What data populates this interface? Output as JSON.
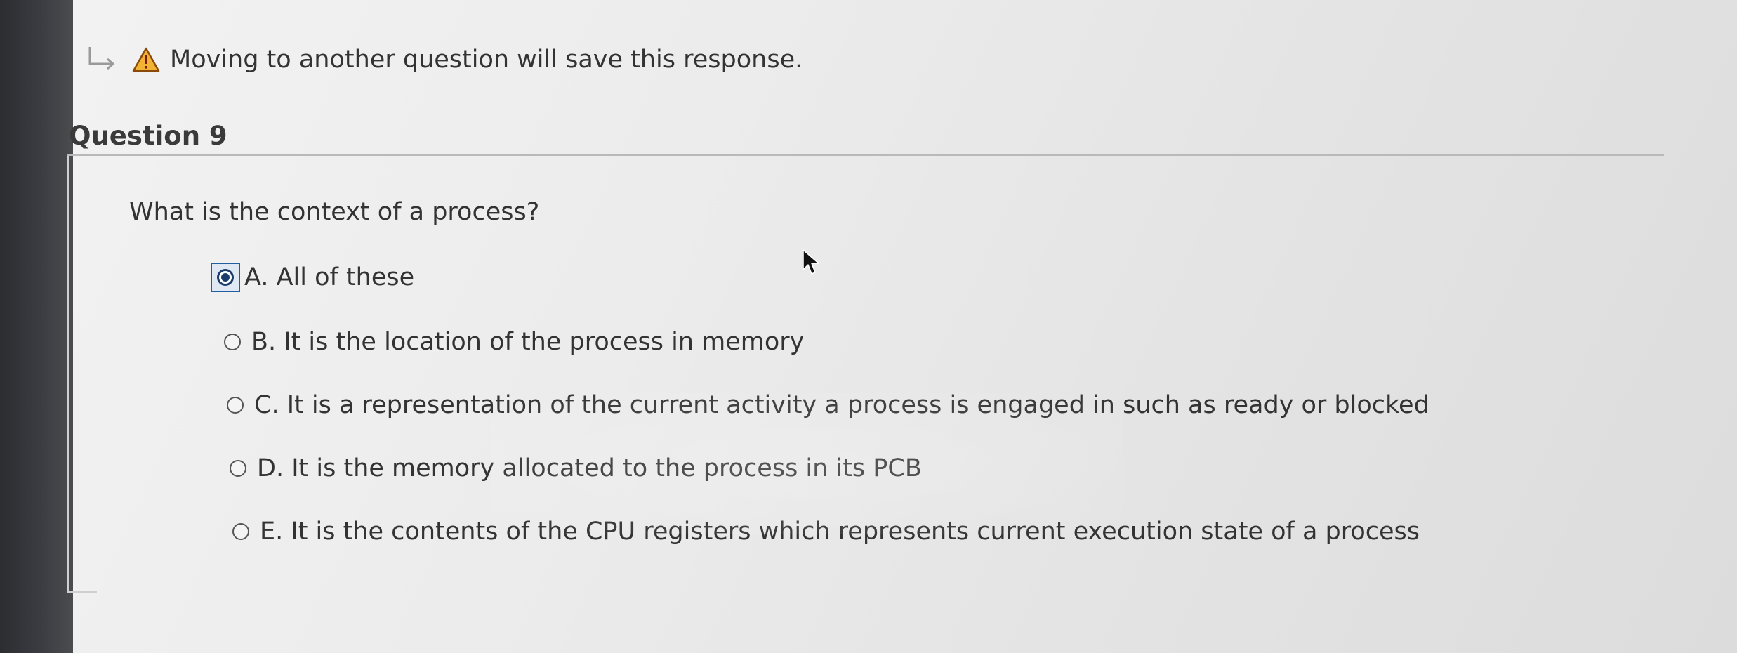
{
  "notice": {
    "text": "Moving to another question will save this response.",
    "arrow_icon": "return-arrow-icon",
    "warning_icon": "warning-icon",
    "warning_color": "#e8a317"
  },
  "question": {
    "title": "Question 9",
    "text": "What is the context of a process?"
  },
  "answers": [
    {
      "label": "A. All of these",
      "selected": true
    },
    {
      "label": "B. It is the location of the process in memory",
      "selected": false
    },
    {
      "label": "C. It is a representation of the current activity a process is engaged in such as ready or blocked",
      "selected": false
    },
    {
      "label": "D. It is the memory allocated to the process in its PCB",
      "selected": false
    },
    {
      "label": "E. It is the contents of the CPU registers which represents current execution state of a process",
      "selected": false
    }
  ],
  "colors": {
    "selected_radio": "#1b3c6b",
    "focus_outline": "#1f5f9f"
  }
}
